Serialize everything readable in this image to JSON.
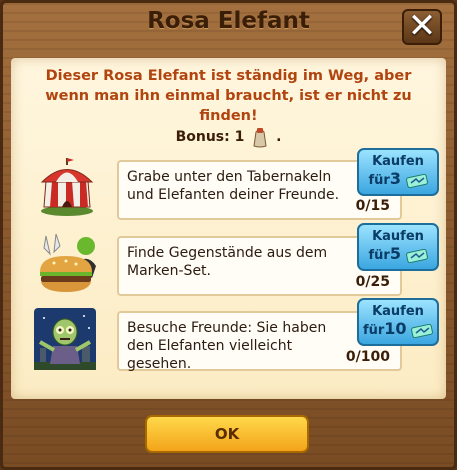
{
  "dialog": {
    "title": "Rosa Elefant",
    "close_label": "✕",
    "intro": "Dieser Rosa Elefant ist ständig im Weg, aber wenn man ihn einmal braucht, ist er nicht zu finden!",
    "bonus_label": "Bonus: 1",
    "bonus_suffix": ".",
    "ok_label": "OK"
  },
  "tasks": [
    {
      "text": "Grabe unter den Tabernakeln und Elefanten deiner Freunde.",
      "progress": "0/15",
      "buy_top": "Kaufen",
      "buy_prefix": "für",
      "buy_cost": "3",
      "icon": "circus-tent-icon"
    },
    {
      "text": "Finde Gegenstände aus dem Marken-Set.",
      "progress": "0/25",
      "buy_top": "Kaufen",
      "buy_prefix": "für",
      "buy_cost": "5",
      "icon": "burger-collection-icon"
    },
    {
      "text": "Besuche Freunde: Sie haben den Elefanten vielleicht gesehen.",
      "progress": "0/100",
      "buy_top": "Kaufen",
      "buy_prefix": "für",
      "buy_cost": "10",
      "icon": "zombie-icon"
    }
  ],
  "colors": {
    "intro_text": "#b1440f",
    "buy_button": "#3ba6e0",
    "ok_button": "#f3a41a"
  }
}
